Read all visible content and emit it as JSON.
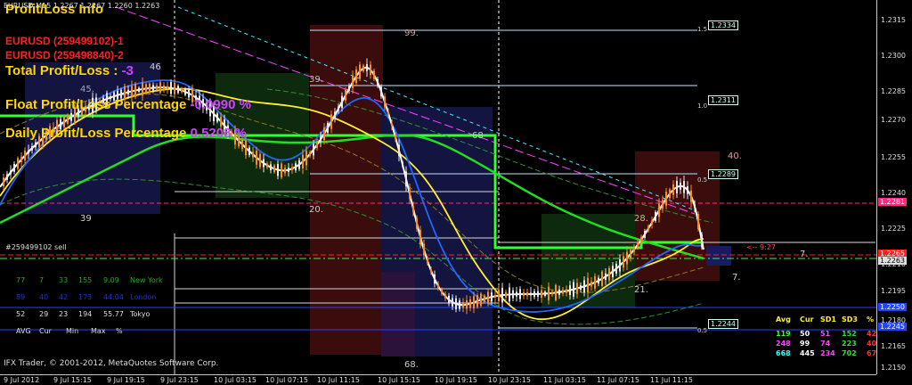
{
  "window": {
    "symbol_line": "EURUSD,M15 1.2267 1.2267 1.2260 1.2263",
    "copyright": "IFX Trader, © 2001-2012, MetaQuotes Software Corp."
  },
  "info_panel": {
    "title": "Profit/Loss Info",
    "order_1": "EURUSD (259499102)-1",
    "order_2": "EURUSD (259498840)-2",
    "total_label": "Total Profit/Loss : ",
    "total_value": "-3",
    "float_label": "Float Profit/Loss Percentage ",
    "float_value": "-0.0990 %",
    "daily_label": "Daily Profit/Loss Percentage ",
    "daily_value": "0.5208 %"
  },
  "order_label": "#259499102 sell",
  "colors": {
    "title": "#ffd700",
    "order": "#ff2020",
    "value": "#d040ff",
    "candle_bull": "#e8e8e8",
    "candle_bear": "#ff8c1a",
    "ma_green": "#22dd22",
    "ma_yellow": "#ffee33",
    "ma_blue": "#2266ff"
  },
  "sessions": {
    "rows": [
      {
        "values": [
          "77",
          "7",
          "33",
          "155",
          "9.09"
        ],
        "name": "New York",
        "color": "#22aa22"
      },
      {
        "values": [
          "89",
          "40",
          "42",
          "173",
          "44.04"
        ],
        "name": "London",
        "color": "#2233dd"
      },
      {
        "values": [
          "52",
          "29",
          "23",
          "194",
          "55.77"
        ],
        "name": "Tokyo",
        "color": "#dddddd"
      }
    ],
    "footer": [
      "AVG",
      "Cur",
      "Min",
      "Max",
      "%"
    ]
  },
  "stats": {
    "headers": [
      "Avg",
      "Cur",
      "SD1",
      "SD3",
      "%"
    ],
    "rows": [
      {
        "values": [
          "119",
          "50",
          "51",
          "152",
          "42"
        ],
        "colors": [
          "#33ff33",
          "#ffffff",
          "#ff44ff",
          "#33dd33",
          "#ff3333"
        ]
      },
      {
        "values": [
          "248",
          "99",
          "74",
          "223",
          "40"
        ],
        "colors": [
          "#ff44ff",
          "#ffffff",
          "#ff44ff",
          "#33dd33",
          "#ff3333"
        ]
      },
      {
        "values": [
          "668",
          "445",
          "234",
          "702",
          "67"
        ],
        "colors": [
          "#33ffff",
          "#ffffff",
          "#ff44ff",
          "#33dd33",
          "#ff3333"
        ]
      }
    ]
  },
  "fib": {
    "upper": [
      {
        "level": "1.5",
        "price": "1.2334"
      },
      {
        "level": "1.0",
        "price": "1.2311"
      },
      {
        "level": "0.5",
        "price": "1.2289"
      }
    ],
    "lower": [
      {
        "level": "0.5",
        "price": "1.2244"
      }
    ]
  },
  "zones": [
    "99.",
    "45.",
    "39.",
    "46",
    "39",
    "20.",
    "68.",
    "68",
    "40.",
    "28.",
    "21.",
    "7.",
    "7."
  ],
  "order_marker": "<-- 9:27",
  "price_axis": {
    "labels": [
      "1.2315",
      "1.2300",
      "1.2285",
      "1.2270",
      "1.2255",
      "1.2240",
      "1.2225",
      "1.2210",
      "1.2195",
      "1.2180",
      "1.2165",
      "1.2150"
    ],
    "tags": [
      {
        "text": "1.2281",
        "bg": "#ff2a7f",
        "fg": "#ffffff"
      },
      {
        "text": "1.2265",
        "bg": "#ff2020",
        "fg": "#ffffff"
      },
      {
        "text": "1.2263",
        "bg": "#e0e0e0",
        "fg": "#000000"
      },
      {
        "text": "1.2250",
        "bg": "#2244ff",
        "fg": "#ffffff"
      },
      {
        "text": "1.2245",
        "bg": "#2244ff",
        "fg": "#ffffff"
      }
    ]
  },
  "time_axis": [
    "9 Jul 2012",
    "9 Jul 15:15",
    "9 Jul 19:15",
    "9 Jul 23:15",
    "10 Jul 03:15",
    "10 Jul 07:15",
    "10 Jul 11:15",
    "10 Jul 15:15",
    "10 Jul 19:15",
    "10 Jul 23:15",
    "11 Jul 03:15",
    "11 Jul 07:15",
    "11 Jul 11:15"
  ]
}
